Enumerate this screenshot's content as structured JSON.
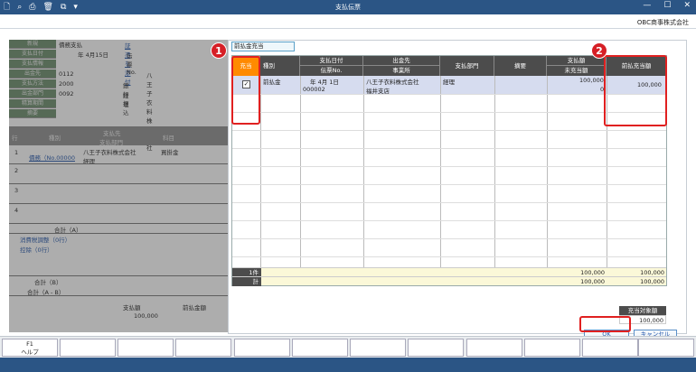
{
  "window": {
    "title": "支払伝票",
    "controls": [
      "—",
      "☐",
      "✕"
    ]
  },
  "app": {
    "company": "OBC商事株式会社"
  },
  "background_form": {
    "rows": [
      {
        "label": "新規",
        "value": "債務支払"
      },
      {
        "label": "支払日付",
        "value": "年 4月15日"
      },
      {
        "label": "支払情報",
        "value": ""
      },
      {
        "label": "出金先",
        "value": "0112"
      },
      {
        "label": "支払方法",
        "value": "2000"
      },
      {
        "label": "出金部門",
        "value": "0092"
      },
      {
        "label": "精算期間",
        "value": ""
      },
      {
        "label": "摘要",
        "value": ""
      }
    ],
    "evidence_link": "証憑を添付",
    "voucher_no": "伝票No.",
    "payee_name": "八王子衣料株式会社",
    "bank_transfer": "銀行振込",
    "dept_name": "経理",
    "grid": {
      "headers": [
        "行",
        "種別",
        "支払先",
        "支払部門",
        "科目"
      ],
      "row1_type": "債務（No.00000",
      "row1_payee": "八王子衣料株式会社",
      "row1_dept": "経理",
      "row1_account": "買掛金",
      "row_numbers": [
        "1",
        "2",
        "3",
        "4"
      ],
      "total_a": "合計（A）",
      "tax_adjust": "消費税調整（0行）",
      "deduction": "控除（0行）",
      "total_b": "合計（B）",
      "total_ab": "合計（A - B）",
      "pay_amount_label": "支払額",
      "prepaid_label": "前払金額",
      "pay_amount": "100,000"
    }
  },
  "dialog": {
    "tab_title": "前払金充当",
    "columns": {
      "apply": "充当",
      "type": "種別",
      "pay_date": "支払日付",
      "voucher_no": "伝票No.",
      "payee": "出金先",
      "office": "事業所",
      "pay_dept": "支払部門",
      "memo": "摘要",
      "pay_amount": "支払額",
      "unapplied": "未充当額",
      "prepaid_apply": "前払充当額"
    },
    "row": {
      "checked": true,
      "type": "前払金",
      "pay_date": "年  4月  1日",
      "voucher_no": "000002",
      "payee": "八王子衣料株式会社",
      "office": "福井支店",
      "pay_dept": "経理",
      "pay_amount": "100,000",
      "unapplied": "0",
      "prepaid_apply": "100,000"
    },
    "footer": {
      "count_label": "1件",
      "total_label": "計",
      "count_pay": "100,000",
      "count_apply": "100,000",
      "total_pay": "100,000",
      "total_apply": "100,000"
    },
    "target_label": "充当対象額",
    "target_value": "100,000",
    "ok_label": "OK",
    "cancel_label": "キャンセル"
  },
  "callouts": [
    "1",
    "2"
  ],
  "function_keys": [
    {
      "key": "F1",
      "label": "ヘルプ"
    },
    {
      "key": "",
      "label": ""
    },
    {
      "key": "",
      "label": ""
    },
    {
      "key": "",
      "label": ""
    },
    {
      "key": "",
      "label": ""
    },
    {
      "key": "",
      "label": ""
    },
    {
      "key": "",
      "label": ""
    },
    {
      "key": "",
      "label": ""
    },
    {
      "key": "",
      "label": ""
    },
    {
      "key": "",
      "label": ""
    },
    {
      "key": "",
      "label": ""
    },
    {
      "key": "",
      "label": ""
    }
  ],
  "colors": {
    "accent": "#2b5585",
    "apply_header": "#ff8a00",
    "highlight": "#e02020"
  }
}
